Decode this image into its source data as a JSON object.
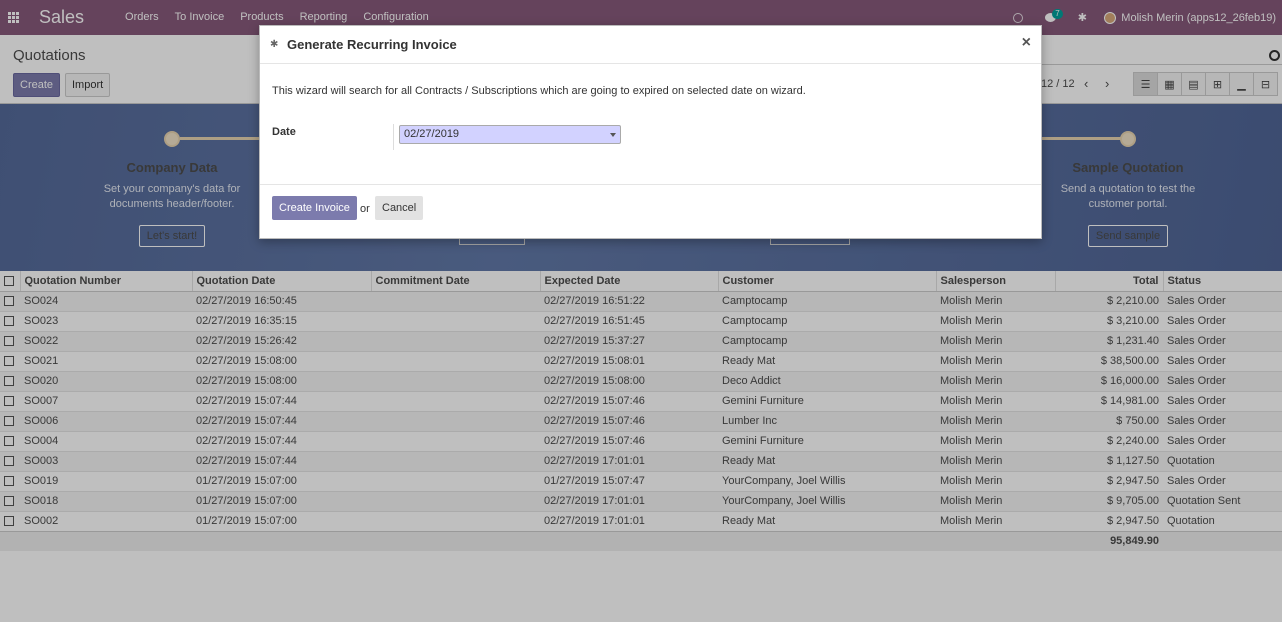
{
  "navbar": {
    "brand": "Sales",
    "menu": [
      "Orders",
      "To Invoice",
      "Products",
      "Reporting",
      "Configuration"
    ],
    "messages_badge": "7",
    "user": "Molish Merin (apps12_26feb19)"
  },
  "control_panel": {
    "breadcrumb": "Quotations",
    "create_label": "Create",
    "import_label": "Import",
    "pager": "12 / 12"
  },
  "banner": {
    "steps": [
      {
        "title": "Company Data",
        "text1": "Set your company's data for",
        "text2": "documents header/footer.",
        "button": "Let's start!"
      },
      {
        "title": "Sample Quotation",
        "text1": "Send a quotation to test the",
        "text2": "customer portal.",
        "button": "Send sample"
      }
    ]
  },
  "table": {
    "headers": [
      "Quotation Number",
      "Quotation Date",
      "Commitment Date",
      "Expected Date",
      "Customer",
      "Salesperson",
      "Total",
      "Status"
    ],
    "rows": [
      [
        "SO024",
        "02/27/2019 16:50:45",
        "",
        "02/27/2019 16:51:22",
        "Camptocamp",
        "Molish Merin",
        "$ 2,210.00",
        "Sales Order"
      ],
      [
        "SO023",
        "02/27/2019 16:35:15",
        "",
        "02/27/2019 16:51:45",
        "Camptocamp",
        "Molish Merin",
        "$ 3,210.00",
        "Sales Order"
      ],
      [
        "SO022",
        "02/27/2019 15:26:42",
        "",
        "02/27/2019 15:37:27",
        "Camptocamp",
        "Molish Merin",
        "$ 1,231.40",
        "Sales Order"
      ],
      [
        "SO021",
        "02/27/2019 15:08:00",
        "",
        "02/27/2019 15:08:01",
        "Ready Mat",
        "Molish Merin",
        "$ 38,500.00",
        "Sales Order"
      ],
      [
        "SO020",
        "02/27/2019 15:08:00",
        "",
        "02/27/2019 15:08:00",
        "Deco Addict",
        "Molish Merin",
        "$ 16,000.00",
        "Sales Order"
      ],
      [
        "SO007",
        "02/27/2019 15:07:44",
        "",
        "02/27/2019 15:07:46",
        "Gemini Furniture",
        "Molish Merin",
        "$ 14,981.00",
        "Sales Order"
      ],
      [
        "SO006",
        "02/27/2019 15:07:44",
        "",
        "02/27/2019 15:07:46",
        "Lumber Inc",
        "Molish Merin",
        "$ 750.00",
        "Sales Order"
      ],
      [
        "SO004",
        "02/27/2019 15:07:44",
        "",
        "02/27/2019 15:07:46",
        "Gemini Furniture",
        "Molish Merin",
        "$ 2,240.00",
        "Sales Order"
      ],
      [
        "SO003",
        "02/27/2019 15:07:44",
        "",
        "02/27/2019 17:01:01",
        "Ready Mat",
        "Molish Merin",
        "$ 1,127.50",
        "Quotation"
      ],
      [
        "SO019",
        "01/27/2019 15:07:00",
        "",
        "01/27/2019 15:07:47",
        "YourCompany, Joel Willis",
        "Molish Merin",
        "$ 2,947.50",
        "Sales Order"
      ],
      [
        "SO018",
        "01/27/2019 15:07:00",
        "",
        "02/27/2019 17:01:01",
        "YourCompany, Joel Willis",
        "Molish Merin",
        "$ 9,705.00",
        "Quotation Sent"
      ],
      [
        "SO002",
        "01/27/2019 15:07:00",
        "",
        "02/27/2019 17:01:01",
        "Ready Mat",
        "Molish Merin",
        "$ 2,947.50",
        "Quotation"
      ]
    ],
    "footer_total": "95,849.90"
  },
  "modal": {
    "title": "Generate Recurring Invoice",
    "close": "×",
    "description": "This wizard will search for all Contracts / Subscriptions which are going to expired on selected date on wizard.",
    "date_label": "Date",
    "date_value": "02/27/2019",
    "create_label": "Create Invoice",
    "or_label": "or",
    "cancel_label": "Cancel"
  }
}
